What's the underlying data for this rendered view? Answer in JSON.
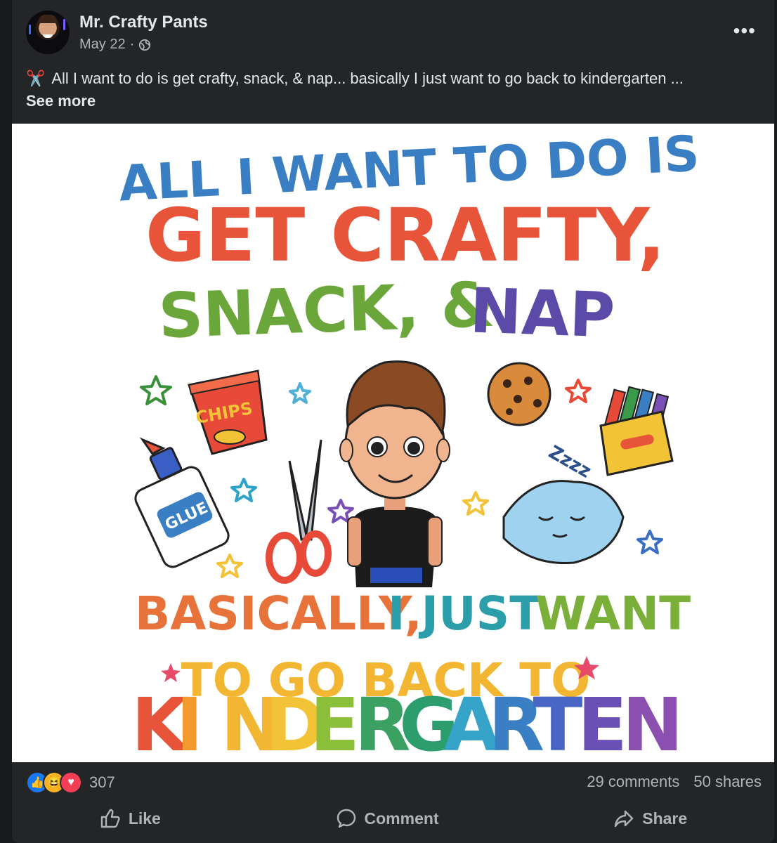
{
  "post": {
    "author": "Mr. Crafty Pants",
    "date": "May 22",
    "date_sep": "·",
    "privacy_icon": "globe-icon",
    "menu": "•••",
    "caption_icon": "✂️",
    "caption": "All I want to do is get crafty, snack, & nap... basically I just want to go back to kindergarten ...",
    "see_more": "See more"
  },
  "image": {
    "line1": "ALL I WANT TO DO IS",
    "line2": "GET CRAFTY,",
    "line3_a": "SNACK, &",
    "line3_b": "NAP",
    "chips_label": "CHIPS",
    "glue_label": "GLUE",
    "zzz": "Zzzz",
    "line4_a": "BASICALLY,",
    "line4_b": "I JUST",
    "line4_c": "WANT",
    "line5": "TO GO BACK TO",
    "kinder_letters": [
      "K",
      "I",
      "N",
      "D",
      "E",
      "R",
      "G",
      "A",
      "R",
      "T",
      "E",
      "N"
    ],
    "kinder_colors": [
      "#e8543a",
      "#f29a2e",
      "#f2b632",
      "#f2c237",
      "#8bbf3a",
      "#3aa163",
      "#2c9e6e",
      "#36a3c9",
      "#3a7fc4",
      "#4a66c4",
      "#6a4fb5",
      "#8b4fb0"
    ]
  },
  "footer": {
    "reaction_count": "307",
    "comments": "29 comments",
    "shares": "50 shares",
    "like": "Like",
    "comment": "Comment",
    "share": "Share"
  },
  "colors": {
    "blue": "#3a7fc4",
    "orange_red": "#e8543a",
    "green": "#6aa63a",
    "purple": "#5b4aa8",
    "yellow": "#f2b632"
  }
}
